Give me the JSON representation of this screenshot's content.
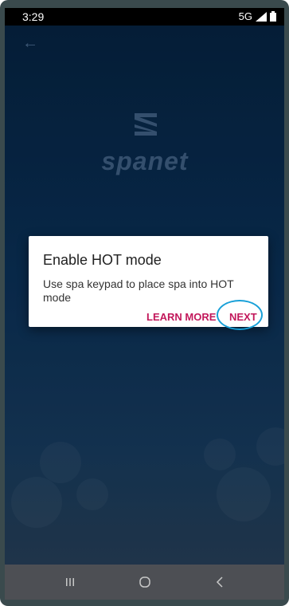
{
  "status_bar": {
    "time": "3:29",
    "network": "5G"
  },
  "logo": {
    "text": "spanet"
  },
  "dialog": {
    "title": "Enable HOT mode",
    "body": "Use spa keypad to place spa into HOT mode",
    "learn_more_label": "LEARN MORE",
    "next_label": "NEXT"
  },
  "icons": {
    "back": "back-arrow-icon",
    "signal": "signal-icon",
    "battery": "battery-icon",
    "recents": "recents-icon",
    "home": "home-icon",
    "nav_back": "nav-back-icon"
  },
  "colors": {
    "accent": "#c2185b",
    "highlight_circle": "#18a0d8",
    "background_top": "#06223f",
    "background_bottom": "#2a3f55"
  }
}
